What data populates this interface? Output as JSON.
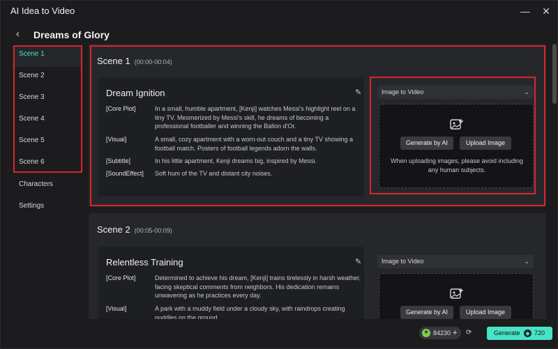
{
  "app": {
    "title": "AI Idea to Video",
    "minimize_label": "—",
    "close_label": "✕"
  },
  "header": {
    "back_label": "‹",
    "project_title": "Dreams of Glory"
  },
  "sidebar": {
    "scenes": [
      {
        "label": "Scene 1",
        "active": true
      },
      {
        "label": "Scene 2"
      },
      {
        "label": "Scene 3"
      },
      {
        "label": "Scene 4"
      },
      {
        "label": "Scene 5"
      },
      {
        "label": "Scene 6"
      }
    ],
    "characters_label": "Characters",
    "settings_label": "Settings"
  },
  "scenes": [
    {
      "heading": "Scene 1",
      "time": "(00:00-00:04)",
      "title": "Dream Ignition",
      "rows": [
        {
          "tag": "[Core Plot]",
          "text": "In a small, humble apartment, [Kenji] watches Messi's highlight reel on a tiny TV. Mesmerized by Messi's skill, he dreams of becoming a professional footballer and winning the Ballon d'Or."
        },
        {
          "tag": "[Visual]",
          "text": "A small, cozy apartment with a worn-out couch and a tiny TV showing a football match. Posters of football legends adorn the walls."
        },
        {
          "tag": "[Subtitle]",
          "text": "In his little apartment, Kenji dreams big, inspired by Messi."
        },
        {
          "tag": "[SoundEffect]",
          "text": "Soft hum of the TV and distant city noises."
        }
      ],
      "media": {
        "select_value": "Image to Video",
        "generate_label": "Generate by AI",
        "upload_label": "Upload Image",
        "note": "When uploading images, please avoid including any human subjects."
      }
    },
    {
      "heading": "Scene 2",
      "time": "(00:05-00:09)",
      "title": "Relentless Training",
      "rows": [
        {
          "tag": "[Core Plot]",
          "text": "Determined to achieve his dream, [Kenji] trains tirelessly in harsh weather, facing skeptical comments from neighbors. His dedication remains unwavering as he practices every day."
        },
        {
          "tag": "[Visual]",
          "text": "A park with a muddy field under a cloudy sky, with raindrops creating puddles on the ground."
        }
      ],
      "media": {
        "select_value": "Image to Video",
        "generate_label": "Generate by AI",
        "upload_label": "Upload Image"
      }
    }
  ],
  "footer": {
    "credits": "84230",
    "generate_label": "Generate",
    "generate_cost": "720"
  },
  "colors": {
    "accent": "#48e3c6",
    "highlight_box": "#d9262d",
    "credit_coin": "#7ed04c"
  }
}
